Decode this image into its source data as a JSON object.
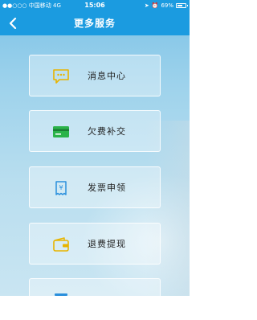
{
  "status": {
    "carrier": "●●○○○ 中国移动  4G",
    "time": "15:06",
    "battery_text": "69%",
    "battery_level": 0.69
  },
  "header": {
    "title": "更多服务",
    "back_icon": "chevron-left-icon"
  },
  "services": [
    {
      "label": "消息中心",
      "icon": "message-icon",
      "color": "#e8b400"
    },
    {
      "label": "欠费补交",
      "icon": "card-icon",
      "color": "#2bb34a"
    },
    {
      "label": "发票申领",
      "icon": "invoice-icon",
      "color": "#2a8fdc"
    },
    {
      "label": "退费提现",
      "icon": "wallet-icon",
      "color": "#e8b400"
    }
  ],
  "colors": {
    "header_bg": "#1b9be0"
  }
}
